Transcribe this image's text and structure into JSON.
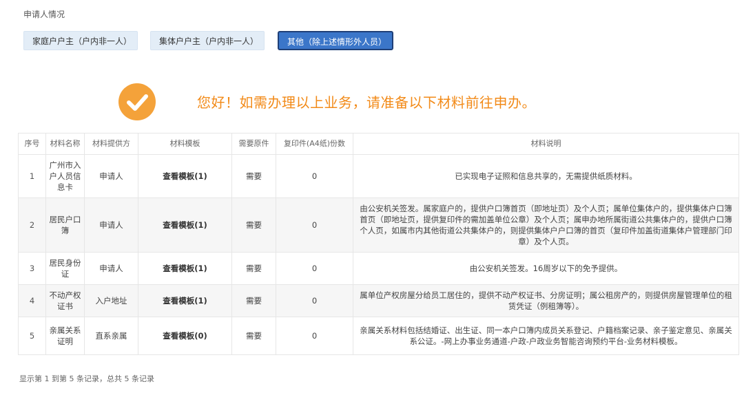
{
  "section_label": "申请人情况",
  "applicant_types": [
    "家庭户户主（户内非一人）",
    "集体户户主（户内非一人）",
    "其他（除上述情形外人员）"
  ],
  "active_type_index": 2,
  "notice": "您好！如需办理以上业务，请准备以下材料前往申办。",
  "table": {
    "headers": {
      "index": "序号",
      "name": "材料名称",
      "provider": "材料提供方",
      "template": "材料模板",
      "original": "需要原件",
      "copies": "复印件(A4纸)份数",
      "desc": "材料说明"
    },
    "rows": [
      {
        "index": "1",
        "name": "广州市入户人员信息卡",
        "provider": "申请人",
        "template": "查看模板(1)",
        "original": "需要",
        "copies": "0",
        "desc": "已实现电子证照和信息共享的，无需提供纸质材料。"
      },
      {
        "index": "2",
        "name": "居民户口簿",
        "provider": "申请人",
        "template": "查看模板(1)",
        "original": "需要",
        "copies": "0",
        "desc": "由公安机关签发。属家庭户的，提供户口簿首页（即地址页）及个人页；属单位集体户的，提供集体户口簿首页（即地址页，提供复印件的需加盖单位公章）及个人页；属申办地所属街道公共集体户的，提供户口簿个人页，如属市内其他街道公共集体户的，则提供集体户户口簿的首页（复印件加盖街道集体户管理部门印章）及个人页。"
      },
      {
        "index": "3",
        "name": "居民身份证",
        "provider": "申请人",
        "template": "查看模板(1)",
        "original": "需要",
        "copies": "0",
        "desc": "由公安机关签发。16周岁以下的免予提供。"
      },
      {
        "index": "4",
        "name": "不动产权证书",
        "provider": "入户地址",
        "template": "查看模板(1)",
        "original": "需要",
        "copies": "0",
        "desc": "属单位产权房屋分给员工居住的，提供不动产权证书、分房证明；属公租房产的，则提供房屋管理单位的租赁凭证（例租簿等）。"
      },
      {
        "index": "5",
        "name": "亲属关系证明",
        "provider": "直系亲属",
        "template": "查看模板(0)",
        "original": "需要",
        "copies": "0",
        "desc": "亲属关系材料包括结婚证、出生证、同一本户口簿内成员关系登记、户籍档案记录、亲子鉴定意见、亲属关系公证。-网上办事业务通道-户政-户政业务智能咨询预约平台-业务材料模板。"
      }
    ]
  },
  "footer": "显示第 1 到第 5 条记录，总共 5 条记录",
  "colors": {
    "accent_orange": "#f28a18",
    "check_circle": "#f4a23a",
    "active_button": "#3b76c9",
    "inactive_button": "#e3edf7"
  },
  "icons": {
    "success": "check-circle-icon"
  }
}
